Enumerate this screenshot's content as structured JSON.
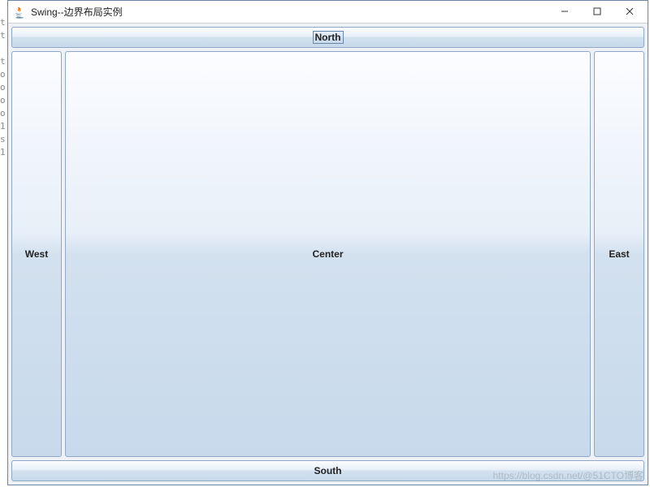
{
  "window": {
    "title": "Swing--边界布局实例"
  },
  "layout": {
    "north": "North",
    "south": "South",
    "west": "West",
    "east": "East",
    "center": "Center"
  },
  "watermark": "https://blog.csdn.net/@51CTO博客",
  "edge_crop_text": "t\nt\n \nt\no\no\no\no\n1\ns\n1"
}
